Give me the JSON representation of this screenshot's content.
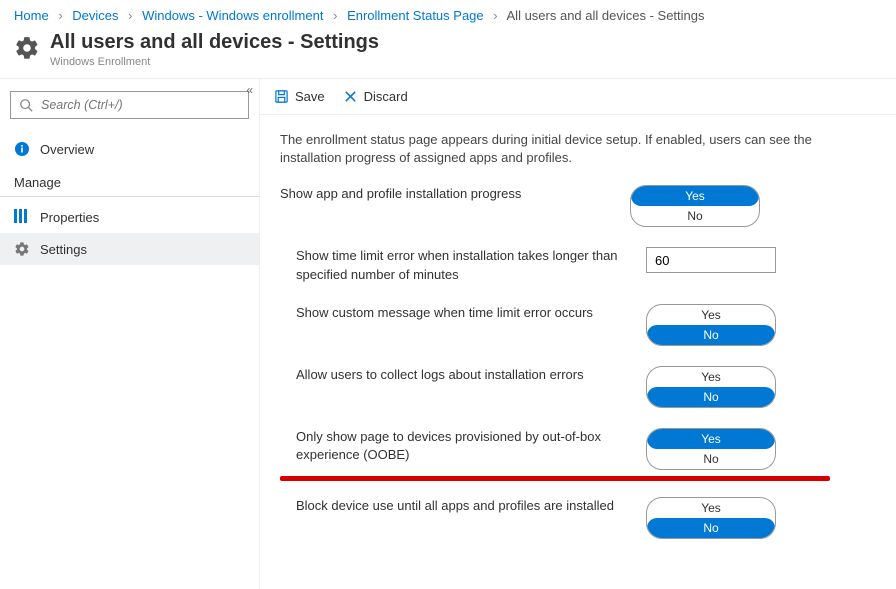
{
  "breadcrumb": {
    "items": [
      "Home",
      "Devices",
      "Windows - Windows enrollment",
      "Enrollment Status Page"
    ],
    "current": "All users and all devices - Settings"
  },
  "header": {
    "title": "All users and all devices - Settings",
    "subtitle": "Windows Enrollment"
  },
  "sidebar": {
    "search_placeholder": "Search (Ctrl+/)",
    "overview": "Overview",
    "manage_label": "Manage",
    "properties": "Properties",
    "settings": "Settings"
  },
  "cmdbar": {
    "save": "Save",
    "discard": "Discard"
  },
  "intro": "The enrollment status page appears during initial device setup. If enabled, users can see the installation progress of assigned apps and profiles.",
  "settings": {
    "show_progress": {
      "label": "Show app and profile installation progress",
      "value": "Yes",
      "yes": "Yes",
      "no": "No"
    },
    "time_limit": {
      "label": "Show time limit error when installation takes longer than specified number of minutes",
      "value": "60"
    },
    "custom_msg": {
      "label": "Show custom message when time limit error occurs",
      "value": "No",
      "yes": "Yes",
      "no": "No"
    },
    "collect_logs": {
      "label": "Allow users to collect logs about installation errors",
      "value": "No",
      "yes": "Yes",
      "no": "No"
    },
    "oobe_only": {
      "label": "Only show page to devices provisioned by out-of-box experience (OOBE)",
      "value": "Yes",
      "yes": "Yes",
      "no": "No"
    },
    "block_use": {
      "label": "Block device use until all apps and profiles are installed",
      "value": "No",
      "yes": "Yes",
      "no": "No"
    }
  }
}
